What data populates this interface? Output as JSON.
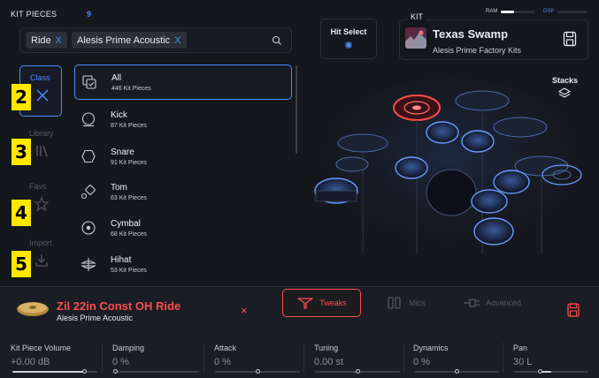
{
  "header": {
    "kit_pieces_title": "KIT PIECES",
    "kit_pieces_count": "9",
    "filter_chips": [
      {
        "label": "Ride",
        "remove": "X"
      },
      {
        "label": "Alesis Prime Acoustic",
        "remove": "X"
      }
    ],
    "hit_select": {
      "label": "Hit Select",
      "icon": "sparkle-icon"
    },
    "kit": {
      "section_label": "KIT",
      "name": "Texas Swamp",
      "source": "Alesis Prime Factory Kits"
    },
    "meters": {
      "ram_label": "RAM",
      "ram_level": 0.4,
      "dsp_label": "DSP",
      "dsp_level": 0.0
    }
  },
  "sidebar": {
    "tabs": [
      {
        "label": "Class",
        "icon": "close-icon",
        "active": true
      },
      {
        "label": "Library",
        "icon": "library-icon",
        "active": false
      },
      {
        "label": "Favs",
        "icon": "star-icon",
        "active": false
      },
      {
        "label": "Import",
        "icon": "import-icon",
        "active": false
      }
    ],
    "badges": [
      "2",
      "3",
      "4",
      "5"
    ]
  },
  "list": {
    "items": [
      {
        "name": "All",
        "count": "446 Kit Pieces",
        "icon": "all-icon",
        "selected": true
      },
      {
        "name": "Kick",
        "count": "87 Kit Pieces",
        "icon": "kick-icon",
        "selected": false
      },
      {
        "name": "Snare",
        "count": "91 Kit Pieces",
        "icon": "snare-icon",
        "selected": false
      },
      {
        "name": "Tom",
        "count": "63 Kit Pieces",
        "icon": "tom-icon",
        "selected": false
      },
      {
        "name": "Cymbal",
        "count": "68 Kit Pieces",
        "icon": "cymbal-icon",
        "selected": false
      },
      {
        "name": "Hihat",
        "count": "53 Kit Pieces",
        "icon": "hihat-icon",
        "selected": false
      }
    ]
  },
  "stacks": {
    "label": "Stacks",
    "icon": "layers-icon"
  },
  "selected_piece": {
    "name": "Zil 22in Const OH Ride",
    "source": "Alesis Prime Acoustic",
    "remove": "×"
  },
  "tabs": [
    {
      "label": "Tweaks",
      "icon": "tweaks-icon",
      "active": true
    },
    {
      "label": "Mics",
      "icon": "mics-icon",
      "active": false
    },
    {
      "label": "Advanced",
      "icon": "advanced-icon",
      "active": false
    }
  ],
  "params": [
    {
      "label": "Kit Piece Volume",
      "value": "+0.00 dB",
      "level": 0.85
    },
    {
      "label": "Damping",
      "value": "0 %",
      "level": 0.0
    },
    {
      "label": "Attack",
      "value": "0 %",
      "level": 0.5
    },
    {
      "label": "Tuning",
      "value": "0.00 st",
      "level": 0.5
    },
    {
      "label": "Dynamics",
      "value": "0 %",
      "level": 0.5
    },
    {
      "label": "Pan",
      "value": "30 L",
      "level": 0.35
    }
  ],
  "colors": {
    "accent": "#4b8cff",
    "active_red": "#ff4d4d",
    "badge": "#ffe800",
    "background": "#14171c"
  }
}
